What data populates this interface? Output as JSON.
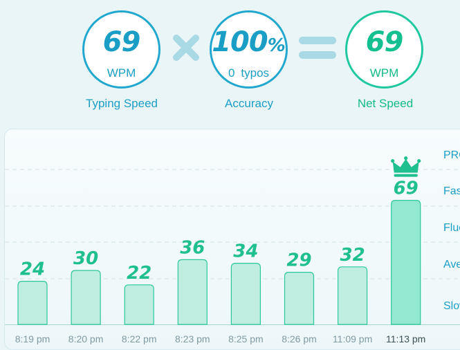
{
  "stats": {
    "typing_speed": {
      "value": "69",
      "unit": "WPM",
      "caption": "Typing Speed"
    },
    "accuracy": {
      "value": "100",
      "percent_sign": "%",
      "typos_count": "0",
      "typos_label": "typos",
      "caption": "Accuracy"
    },
    "net_speed": {
      "value": "69",
      "unit": "WPM",
      "caption": "Net Speed"
    }
  },
  "operators": {
    "multiply_icon": "multiply-icon",
    "equals_icon": "equals-icon"
  },
  "colors": {
    "accent_blue": "#22a8cf",
    "accent_green": "#1fc9a0",
    "bar_fill": "#bfeee0",
    "best_bar_fill": "#93e8d2"
  },
  "chart_data": {
    "type": "bar",
    "categories": [
      "8:19 pm",
      "8:20 pm",
      "8:22 pm",
      "8:23 pm",
      "8:25 pm",
      "8:26 pm",
      "11:09 pm",
      "11:13 pm"
    ],
    "values": [
      24,
      30,
      22,
      36,
      34,
      29,
      32,
      69
    ],
    "best_index": 7,
    "best_icon": "crown-icon",
    "tiers": [
      "PRO",
      "Fast",
      "Fluent",
      "Average",
      "Slow"
    ],
    "grid": true
  }
}
